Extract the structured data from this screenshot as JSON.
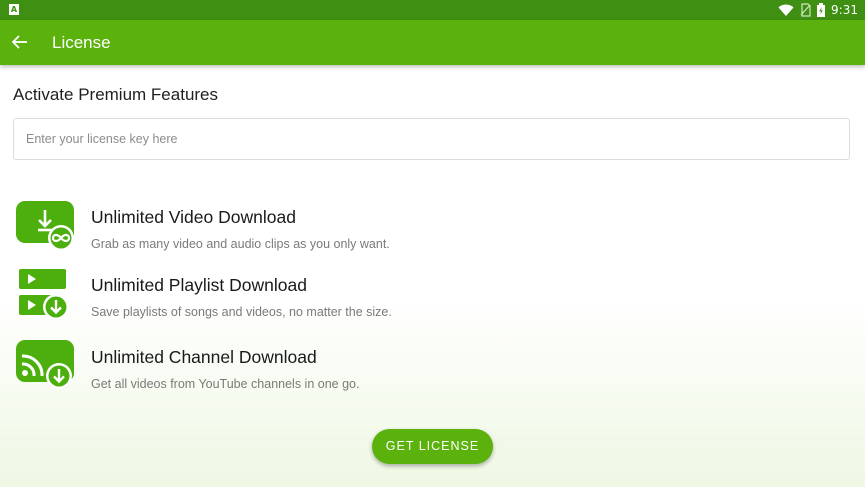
{
  "status_bar": {
    "left_icon": "A",
    "icons": [
      "wifi-icon",
      "sim-icon",
      "battery-icon"
    ],
    "time": "9:31"
  },
  "app_bar": {
    "back_icon": "arrow-back-icon",
    "title": "License"
  },
  "license": {
    "heading": "Activate Premium Features",
    "input_value": "",
    "input_placeholder": "Enter your license key here"
  },
  "features": [
    {
      "icon": "video-download-infinity-icon",
      "title": "Unlimited Video Download",
      "description": "Grab as many video and audio clips as you only want."
    },
    {
      "icon": "playlist-download-icon",
      "title": "Unlimited Playlist Download",
      "description": "Save playlists of songs and videos, no matter the size."
    },
    {
      "icon": "channel-download-icon",
      "title": "Unlimited Channel Download",
      "description": "Get all videos from YouTube channels in one go."
    }
  ],
  "button": {
    "label": "GET LICENSE"
  },
  "colors": {
    "status_bar": "#3f8f12",
    "app_bar": "#5bb20c",
    "accent": "#5bb20c",
    "icon_green": "#4caf0e"
  }
}
